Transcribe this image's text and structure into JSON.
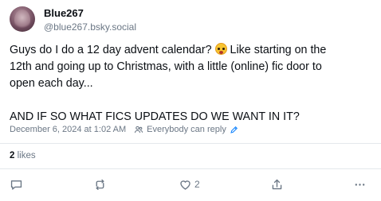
{
  "author": {
    "display_name": "Blue267",
    "handle": "@blue267.bsky.social"
  },
  "post": {
    "lines": [
      "Guys do I do a 12 day advent calendar?",
      "Like starting on the",
      "12th and going up to Christmas, with a little (online) fic door to",
      "open each day...",
      "AND IF SO WHAT FICS UPDATES DO WE WANT IN IT?"
    ],
    "emoji": "astonished-face-emoji"
  },
  "meta": {
    "timestamp": "December 6, 2024 at 1:02 AM",
    "reply_setting": "Everybody can reply"
  },
  "stats": {
    "likes_count": "2",
    "likes_label": "likes"
  },
  "actions": {
    "reply_icon": "reply-icon",
    "repost_icon": "repost-icon",
    "like_icon": "heart-icon",
    "like_count": "2",
    "share_icon": "share-icon",
    "more_icon": "more-icon"
  },
  "colors": {
    "text": "#0b0f14",
    "muted": "#6b7785",
    "divider": "#e4e8ec",
    "link_accent": "#1083fe"
  }
}
